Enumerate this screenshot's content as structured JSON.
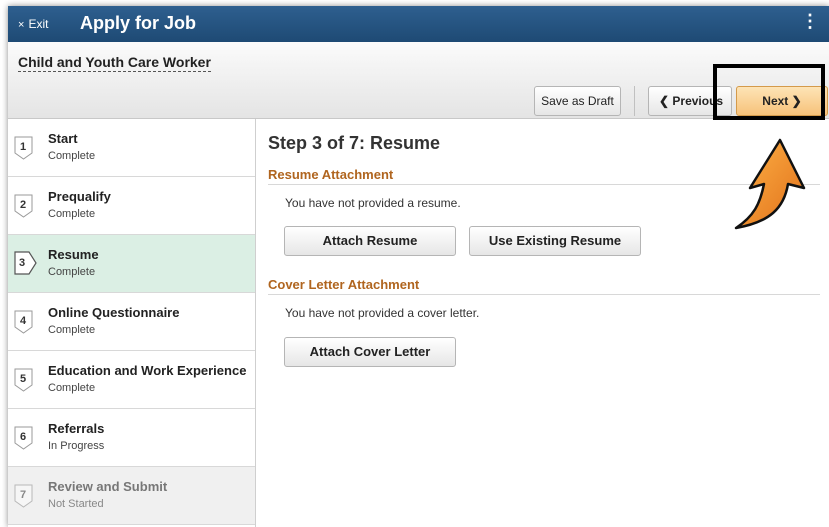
{
  "titlebar": {
    "exit_icon": "×",
    "exit_label": "Exit",
    "title": "Apply for Job",
    "menu_icon": "⋮"
  },
  "job": {
    "title": "Child and Youth Care Worker"
  },
  "toolbar": {
    "save_draft_label": "Save as Draft",
    "previous_label": "❮ Previous",
    "next_label": "Next ❯"
  },
  "steps": [
    {
      "number": "1",
      "name": "Start",
      "status": "Complete"
    },
    {
      "number": "2",
      "name": "Prequalify",
      "status": "Complete"
    },
    {
      "number": "3",
      "name": "Resume",
      "status": "Complete"
    },
    {
      "number": "4",
      "name": "Online Questionnaire",
      "status": "Complete"
    },
    {
      "number": "5",
      "name": "Education and Work Experience",
      "status": "Complete"
    },
    {
      "number": "6",
      "name": "Referrals",
      "status": "In Progress"
    },
    {
      "number": "7",
      "name": "Review and Submit",
      "status": "Not Started"
    }
  ],
  "main": {
    "step_title": "Step 3 of 7: Resume",
    "resume_section": {
      "heading": "Resume Attachment",
      "message": "You have not provided a resume.",
      "attach_label": "Attach Resume",
      "existing_label": "Use Existing Resume"
    },
    "cover_section": {
      "heading": "Cover Letter Attachment",
      "message": "You have not provided a cover letter.",
      "attach_label": "Attach Cover Letter"
    }
  },
  "colors": {
    "titlebar": "#1e4a74",
    "active_step": "#dbefe4",
    "section_heading": "#b0651f",
    "next_button": "#f7c27a",
    "annotation_arrow": "#f08a24"
  }
}
